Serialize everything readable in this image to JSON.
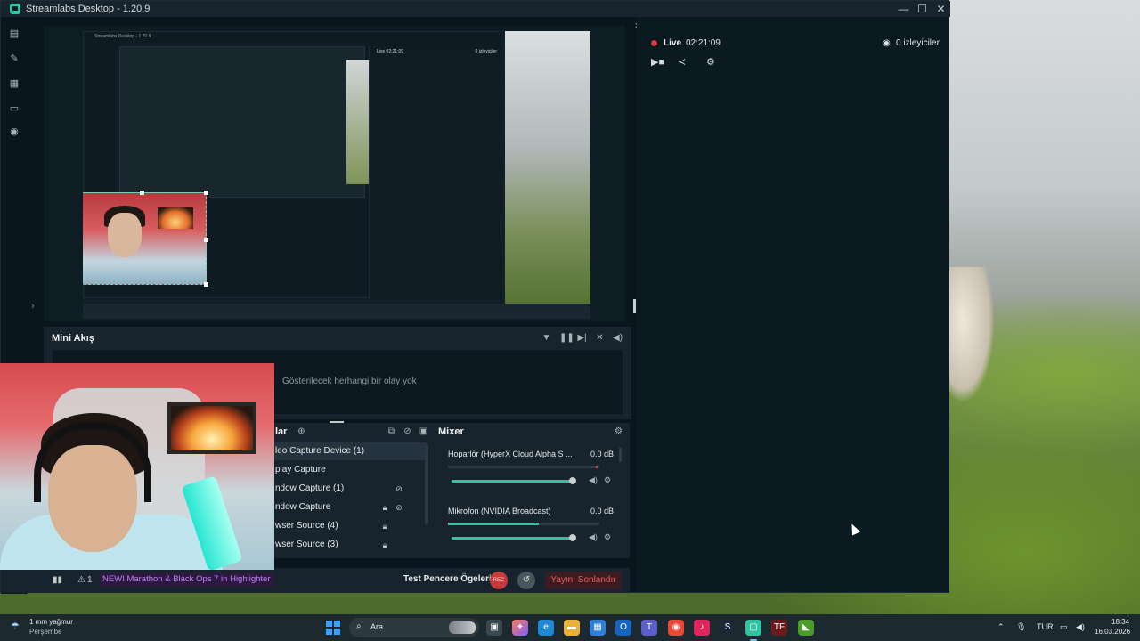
{
  "window": {
    "title": "Streamlabs Desktop - 1.20.9",
    "controls": {
      "minimize": "—",
      "maximize": "☐",
      "close": "✕"
    }
  },
  "nav": {
    "icons": [
      "editor-icon",
      "themes-icon",
      "store-icon",
      "library-icon",
      "replay-icon"
    ]
  },
  "preview": {
    "inner_title": "Streamlabs Desktop - 1.20.9",
    "mini_live": "Live 02:21:09",
    "mini_viewers": "0 izleyiciler"
  },
  "mini_akis": {
    "title": "Mini Akış",
    "empty_text": "Gösterilecek herhangi bir olay yok"
  },
  "sources": {
    "title_partial": "lar",
    "items": [
      {
        "label": "leo Capture Device (1)",
        "selected": true
      },
      {
        "label": "play Capture"
      },
      {
        "label": "ndow Capture (1)"
      },
      {
        "label": "ndow Capture"
      },
      {
        "label": "wser Source (4)"
      },
      {
        "label": "wser Source (3)"
      }
    ]
  },
  "mixer": {
    "title": "Mixer",
    "channels": [
      {
        "name": "Hoparlör (HyperX Cloud Alpha S ...",
        "db": "0.0 dB",
        "level": 0.0,
        "volume": 1.0
      },
      {
        "name": "Mikrofon (NVIDIA Broadcast)",
        "db": "0.0 dB",
        "level": 0.6,
        "volume": 1.0
      }
    ]
  },
  "footer": {
    "promo": "NEW! Marathon & Black Ops 7 in Highlighter",
    "alert_count": "1",
    "test_label": "Test Pencere Ögeleri",
    "rec_label": "REC",
    "end_stream": "Yayını Sonlandır"
  },
  "chat": {
    "live_label": "Live",
    "live_time": "02:21:09",
    "viewers": "0 izleyiciler"
  },
  "taskbar": {
    "weather_line1": "1 mm yağmur",
    "weather_line2": "Perşembe",
    "search_placeholder": "Ara",
    "lang": "TUR",
    "time": "18:34",
    "date": "16.03.2026"
  },
  "colors": {
    "accent": "#31c3a2",
    "live": "#e0353c",
    "promo": "#c77dff",
    "end": "#f05b5b"
  }
}
